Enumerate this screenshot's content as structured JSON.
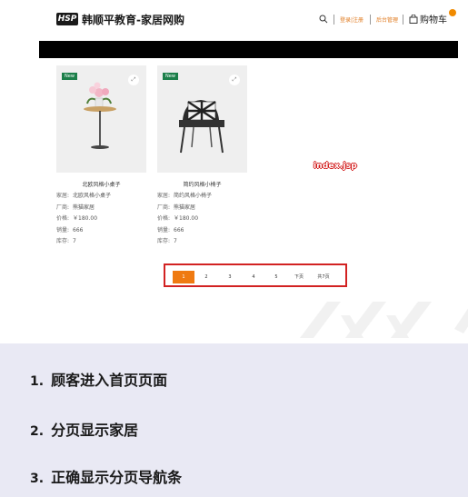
{
  "header": {
    "logo_text": "HSP",
    "title": "韩顺平教育-家居网购",
    "nav_login": "登录|注册",
    "nav_admin": "后台管理",
    "cart_label": "购物车",
    "cart_count": ""
  },
  "products": [
    {
      "badge": "New",
      "name": "北欧风格小桌子",
      "labels": {
        "name": "家居:",
        "maker": "厂商:",
        "price": "价格:",
        "sales": "销量:",
        "stock": "库存:"
      },
      "name_value": "北欧风格小桌子",
      "maker": "熊猫家居",
      "price": "￥180.00",
      "sales": "666",
      "stock": "7"
    },
    {
      "badge": "New",
      "name": "简约风格小椅子",
      "labels": {
        "name": "家居:",
        "maker": "厂商:",
        "price": "价格:",
        "sales": "销量:",
        "stock": "库存:"
      },
      "name_value": "简约风格小椅子",
      "maker": "熊猫家居",
      "price": "￥180.00",
      "sales": "666",
      "stock": "7"
    }
  ],
  "annotation": "index.jsp",
  "pagination": {
    "pages": [
      "1",
      "2",
      "3",
      "4",
      "5"
    ],
    "active": "1",
    "next": "下页",
    "total": "共7页"
  },
  "steps": [
    {
      "num": "1.",
      "text": "顾客进入首页页面"
    },
    {
      "num": "2.",
      "text": "分页显示家居"
    },
    {
      "num": "3.",
      "text": "正确显示分页导航条"
    }
  ],
  "colors": {
    "accent": "#ef7a11",
    "new_badge": "#1c7f4a",
    "frame": "#d22222",
    "panel": "#e9e9f4"
  }
}
